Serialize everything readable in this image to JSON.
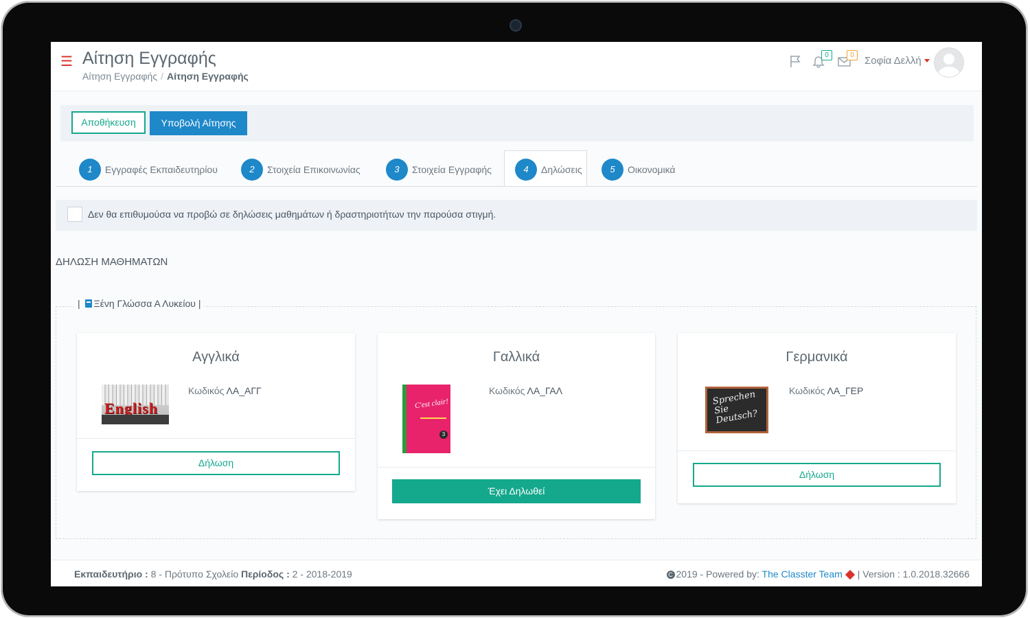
{
  "header": {
    "title": "Αίτηση Εγγραφής",
    "breadcrumb": [
      "Αίτηση Εγγραφής",
      "Αίτηση Εγγραφής"
    ],
    "notifications_count": "0",
    "messages_count": "0",
    "user_name": "Σοφία Δελλή"
  },
  "toolbar": {
    "save_label": "Αποθήκευση",
    "submit_label": "Υποβολή Αίτησης"
  },
  "steps": [
    {
      "num": "1",
      "label": "Εγγραφές Εκπαιδευτηρίου"
    },
    {
      "num": "2",
      "label": "Στοιχεία Επικοινωνίας"
    },
    {
      "num": "3",
      "label": "Στοιχεία Εγγραφής"
    },
    {
      "num": "4",
      "label": "Δηλώσεις"
    },
    {
      "num": "5",
      "label": "Οικονομικά"
    }
  ],
  "opt_out_text": "Δεν θα επιθυμούσα να προβώ σε δηλώσεις μαθημάτων ή δραστηριοτήτων την παρούσα στιγμή.",
  "section_title": "ΔΗΛΩΣΗ ΜΑΘΗΜΑΤΩΝ",
  "group": {
    "title": "Ξένη Γλώσσα Α Λυκείου",
    "pipe": "|"
  },
  "courses": [
    {
      "name": "Αγγλικά",
      "code_label": "Κωδικός",
      "code": "ΛΑ_ΑΓΓ",
      "button": "Δήλωση",
      "declared": false,
      "image_text": "English"
    },
    {
      "name": "Γαλλικά",
      "code_label": "Κωδικός",
      "code": "ΛΑ_ΓΑΛ",
      "button": "Έχει Δηλωθεί",
      "declared": true,
      "image_text": "C'est clair!",
      "image_num": "3"
    },
    {
      "name": "Γερμανικά",
      "code_label": "Κωδικός",
      "code": "ΛΑ_ΓΕΡ",
      "button": "Δήλωση",
      "declared": false,
      "image_text": "Sprechen Sie Deutsch?"
    }
  ],
  "footer": {
    "school_label": "Εκπαιδευτήριο :",
    "school_value": "8 - Πρότυπο Σχολείο",
    "period_label": "Περίοδος :",
    "period_value": "2 - 2018-2019",
    "copyright": "2019 - Powered by:",
    "team": "The Classter Team",
    "version": "| Version : 1.0.2018.32666"
  },
  "colors": {
    "primary": "#1e88c9",
    "accent": "#14a88c",
    "danger": "#d9332b"
  }
}
